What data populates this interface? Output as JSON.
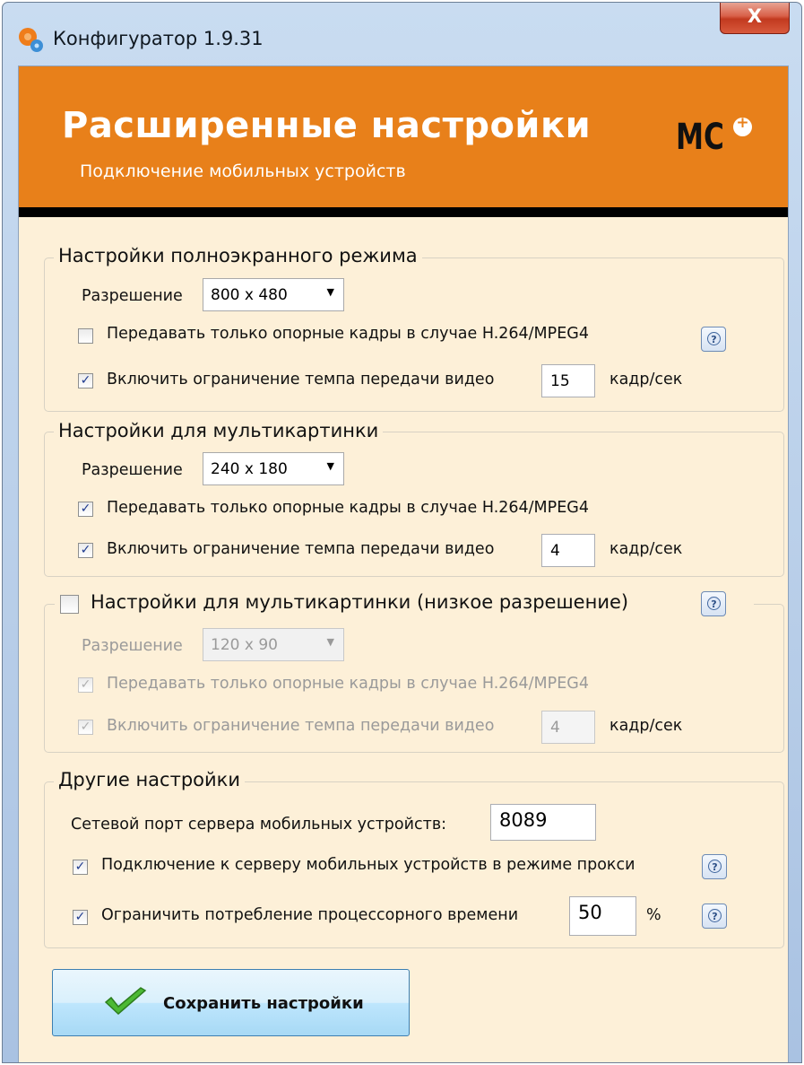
{
  "window": {
    "title": "Конфигуратор 1.9.31",
    "close_label": "X"
  },
  "header": {
    "title": "Расширенные настройки",
    "subtitle": "Подключение мобильных устройств",
    "logo_text": "MC"
  },
  "fullscreen": {
    "legend": "Настройки полноэкранного режима",
    "resolution_label": "Разрешение",
    "resolution_value": "800 x 480",
    "keyframes_label": "Передавать только опорные кадры в случае H.264/MPEG4",
    "keyframes_checked": false,
    "rate_label": "Включить ограничение темпа передачи видео",
    "rate_checked": true,
    "rate_value": "15",
    "rate_unit": "кадр/сек"
  },
  "multi": {
    "legend": "Настройки для мультикартинки",
    "resolution_label": "Разрешение",
    "resolution_value": "240 x 180",
    "keyframes_label": "Передавать только опорные кадры в случае H.264/MPEG4",
    "keyframes_checked": true,
    "rate_label": "Включить ограничение темпа передачи видео",
    "rate_checked": true,
    "rate_value": "4",
    "rate_unit": "кадр/сек"
  },
  "multi_low": {
    "legend": "Настройки для мультикартинки (низкое разрешение)",
    "enabled": false,
    "resolution_label": "Разрешение",
    "resolution_value": "120 x 90",
    "keyframes_label": "Передавать только опорные кадры в случае H.264/MPEG4",
    "keyframes_checked": true,
    "rate_label": "Включить ограничение темпа передачи видео",
    "rate_checked": true,
    "rate_value": "4",
    "rate_unit": "кадр/сек"
  },
  "other": {
    "legend": "Другие настройки",
    "port_label": "Сетевой порт сервера мобильных устройств:",
    "port_value": "8089",
    "proxy_label": "Подключение к серверу мобильных устройств в режиме прокси",
    "proxy_checked": true,
    "cpu_label": "Ограничить потребление процессорного времени",
    "cpu_checked": true,
    "cpu_value": "50",
    "cpu_unit": "%"
  },
  "help_glyph": "?",
  "check_glyph": "✓",
  "arrow_glyph": "▼",
  "save_button": {
    "label": "Сохранить настройки",
    "icon": "checkmark-icon"
  }
}
